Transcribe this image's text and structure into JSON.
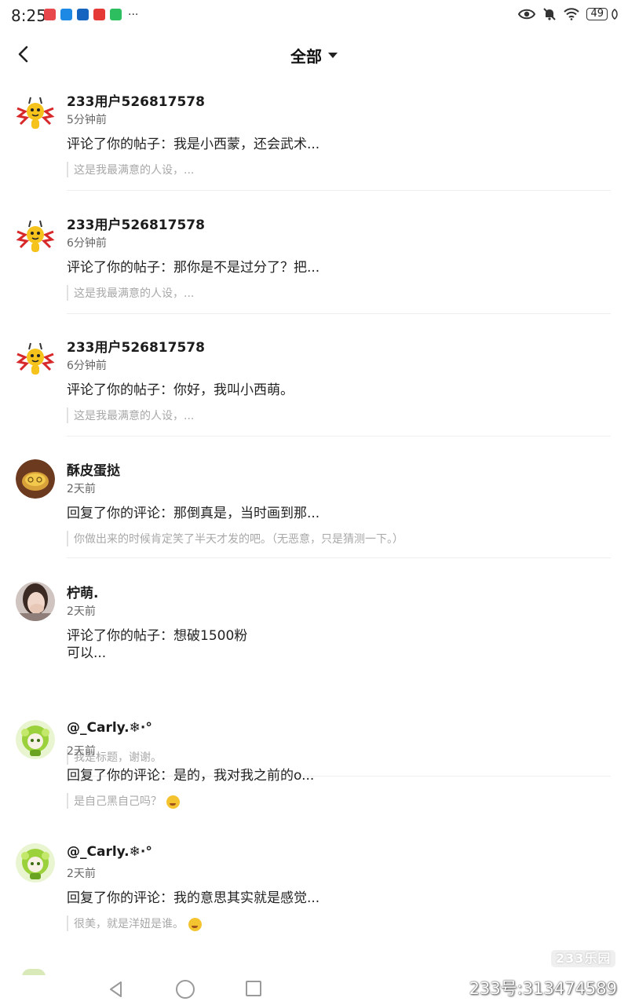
{
  "status_bar": {
    "time": "8:25",
    "more": "···",
    "battery": "49",
    "app_icons": [
      {
        "name": "red-app-icon",
        "color": "#e8474c"
      },
      {
        "name": "blue-app-icon",
        "color": "#1e88e5"
      },
      {
        "name": "blue-cloud-app-icon",
        "color": "#1565c0"
      },
      {
        "name": "red-news-app-icon",
        "color": "#e53935"
      },
      {
        "name": "wechat-icon",
        "color": "#2dbe60"
      }
    ]
  },
  "header": {
    "title": "全部"
  },
  "notifications": [
    {
      "user": "233用户526817578",
      "time": "5分钟前",
      "text": "评论了你的帖子：我是小西蒙，还会武术...",
      "quote": "这是我最满意的人设，...",
      "avatar": "yellow-mascot"
    },
    {
      "user": "233用户526817578",
      "time": "6分钟前",
      "text": "评论了你的帖子：那你是不是过分了？把...",
      "quote": "这是我最满意的人设，...",
      "avatar": "yellow-mascot"
    },
    {
      "user": "233用户526817578",
      "time": "6分钟前",
      "text": "评论了你的帖子：你好，我叫小西萌。",
      "quote": "这是我最满意的人设，...",
      "avatar": "yellow-mascot"
    },
    {
      "user": "酥皮蛋挞",
      "time": "2天前",
      "text": "回复了你的评论：那倒真是，当时画到那...",
      "quote": "你做出来的时候肯定笑了半天才发的吧。（无恶意，只是猜测一下。）",
      "avatar": "egg-tart"
    },
    {
      "user": "柠萌.",
      "time": "2天前",
      "text": "评论了你的帖子：想破1500粉\n可以...",
      "quote": "我是标题，谢谢。",
      "avatar": "photo-girl"
    },
    {
      "user": "@_Carly.❄·°",
      "time": "2天前",
      "text": "回复了你的评论：是的，我对我之前的o...",
      "quote": "是自己黑自己吗？",
      "avatar": "green-anime"
    },
    {
      "user": "@_Carly.❄·°",
      "time": "2天前",
      "text": "回复了你的评论：我的意思其实就是感觉...",
      "quote": "很美，就是洋妞是谁。",
      "avatar": "green-anime"
    }
  ],
  "watermark": {
    "logo": "233乐园",
    "id": "233号:313474589"
  },
  "colors": {
    "text_primary": "#222222",
    "text_secondary": "#666666",
    "quote_text": "#a8a8a8",
    "divider": "#eeeeee"
  }
}
